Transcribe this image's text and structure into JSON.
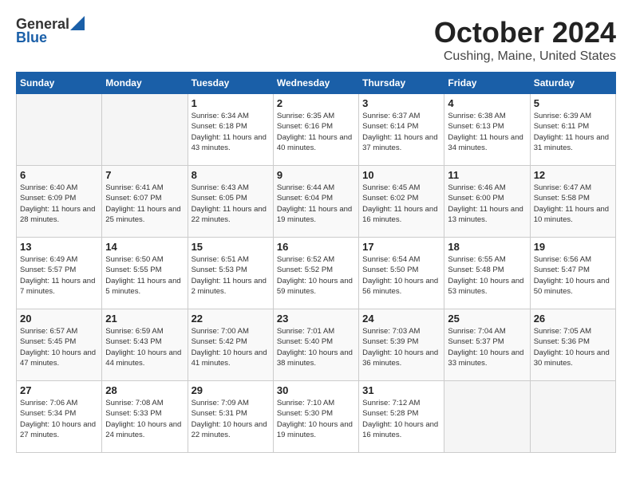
{
  "header": {
    "logo_general": "General",
    "logo_blue": "Blue",
    "month": "October 2024",
    "location": "Cushing, Maine, United States"
  },
  "weekdays": [
    "Sunday",
    "Monday",
    "Tuesday",
    "Wednesday",
    "Thursday",
    "Friday",
    "Saturday"
  ],
  "weeks": [
    [
      {
        "day": "",
        "sunrise": "",
        "sunset": "",
        "daylight": ""
      },
      {
        "day": "",
        "sunrise": "",
        "sunset": "",
        "daylight": ""
      },
      {
        "day": "1",
        "sunrise": "Sunrise: 6:34 AM",
        "sunset": "Sunset: 6:18 PM",
        "daylight": "Daylight: 11 hours and 43 minutes."
      },
      {
        "day": "2",
        "sunrise": "Sunrise: 6:35 AM",
        "sunset": "Sunset: 6:16 PM",
        "daylight": "Daylight: 11 hours and 40 minutes."
      },
      {
        "day": "3",
        "sunrise": "Sunrise: 6:37 AM",
        "sunset": "Sunset: 6:14 PM",
        "daylight": "Daylight: 11 hours and 37 minutes."
      },
      {
        "day": "4",
        "sunrise": "Sunrise: 6:38 AM",
        "sunset": "Sunset: 6:13 PM",
        "daylight": "Daylight: 11 hours and 34 minutes."
      },
      {
        "day": "5",
        "sunrise": "Sunrise: 6:39 AM",
        "sunset": "Sunset: 6:11 PM",
        "daylight": "Daylight: 11 hours and 31 minutes."
      }
    ],
    [
      {
        "day": "6",
        "sunrise": "Sunrise: 6:40 AM",
        "sunset": "Sunset: 6:09 PM",
        "daylight": "Daylight: 11 hours and 28 minutes."
      },
      {
        "day": "7",
        "sunrise": "Sunrise: 6:41 AM",
        "sunset": "Sunset: 6:07 PM",
        "daylight": "Daylight: 11 hours and 25 minutes."
      },
      {
        "day": "8",
        "sunrise": "Sunrise: 6:43 AM",
        "sunset": "Sunset: 6:05 PM",
        "daylight": "Daylight: 11 hours and 22 minutes."
      },
      {
        "day": "9",
        "sunrise": "Sunrise: 6:44 AM",
        "sunset": "Sunset: 6:04 PM",
        "daylight": "Daylight: 11 hours and 19 minutes."
      },
      {
        "day": "10",
        "sunrise": "Sunrise: 6:45 AM",
        "sunset": "Sunset: 6:02 PM",
        "daylight": "Daylight: 11 hours and 16 minutes."
      },
      {
        "day": "11",
        "sunrise": "Sunrise: 6:46 AM",
        "sunset": "Sunset: 6:00 PM",
        "daylight": "Daylight: 11 hours and 13 minutes."
      },
      {
        "day": "12",
        "sunrise": "Sunrise: 6:47 AM",
        "sunset": "Sunset: 5:58 PM",
        "daylight": "Daylight: 11 hours and 10 minutes."
      }
    ],
    [
      {
        "day": "13",
        "sunrise": "Sunrise: 6:49 AM",
        "sunset": "Sunset: 5:57 PM",
        "daylight": "Daylight: 11 hours and 7 minutes."
      },
      {
        "day": "14",
        "sunrise": "Sunrise: 6:50 AM",
        "sunset": "Sunset: 5:55 PM",
        "daylight": "Daylight: 11 hours and 5 minutes."
      },
      {
        "day": "15",
        "sunrise": "Sunrise: 6:51 AM",
        "sunset": "Sunset: 5:53 PM",
        "daylight": "Daylight: 11 hours and 2 minutes."
      },
      {
        "day": "16",
        "sunrise": "Sunrise: 6:52 AM",
        "sunset": "Sunset: 5:52 PM",
        "daylight": "Daylight: 10 hours and 59 minutes."
      },
      {
        "day": "17",
        "sunrise": "Sunrise: 6:54 AM",
        "sunset": "Sunset: 5:50 PM",
        "daylight": "Daylight: 10 hours and 56 minutes."
      },
      {
        "day": "18",
        "sunrise": "Sunrise: 6:55 AM",
        "sunset": "Sunset: 5:48 PM",
        "daylight": "Daylight: 10 hours and 53 minutes."
      },
      {
        "day": "19",
        "sunrise": "Sunrise: 6:56 AM",
        "sunset": "Sunset: 5:47 PM",
        "daylight": "Daylight: 10 hours and 50 minutes."
      }
    ],
    [
      {
        "day": "20",
        "sunrise": "Sunrise: 6:57 AM",
        "sunset": "Sunset: 5:45 PM",
        "daylight": "Daylight: 10 hours and 47 minutes."
      },
      {
        "day": "21",
        "sunrise": "Sunrise: 6:59 AM",
        "sunset": "Sunset: 5:43 PM",
        "daylight": "Daylight: 10 hours and 44 minutes."
      },
      {
        "day": "22",
        "sunrise": "Sunrise: 7:00 AM",
        "sunset": "Sunset: 5:42 PM",
        "daylight": "Daylight: 10 hours and 41 minutes."
      },
      {
        "day": "23",
        "sunrise": "Sunrise: 7:01 AM",
        "sunset": "Sunset: 5:40 PM",
        "daylight": "Daylight: 10 hours and 38 minutes."
      },
      {
        "day": "24",
        "sunrise": "Sunrise: 7:03 AM",
        "sunset": "Sunset: 5:39 PM",
        "daylight": "Daylight: 10 hours and 36 minutes."
      },
      {
        "day": "25",
        "sunrise": "Sunrise: 7:04 AM",
        "sunset": "Sunset: 5:37 PM",
        "daylight": "Daylight: 10 hours and 33 minutes."
      },
      {
        "day": "26",
        "sunrise": "Sunrise: 7:05 AM",
        "sunset": "Sunset: 5:36 PM",
        "daylight": "Daylight: 10 hours and 30 minutes."
      }
    ],
    [
      {
        "day": "27",
        "sunrise": "Sunrise: 7:06 AM",
        "sunset": "Sunset: 5:34 PM",
        "daylight": "Daylight: 10 hours and 27 minutes."
      },
      {
        "day": "28",
        "sunrise": "Sunrise: 7:08 AM",
        "sunset": "Sunset: 5:33 PM",
        "daylight": "Daylight: 10 hours and 24 minutes."
      },
      {
        "day": "29",
        "sunrise": "Sunrise: 7:09 AM",
        "sunset": "Sunset: 5:31 PM",
        "daylight": "Daylight: 10 hours and 22 minutes."
      },
      {
        "day": "30",
        "sunrise": "Sunrise: 7:10 AM",
        "sunset": "Sunset: 5:30 PM",
        "daylight": "Daylight: 10 hours and 19 minutes."
      },
      {
        "day": "31",
        "sunrise": "Sunrise: 7:12 AM",
        "sunset": "Sunset: 5:28 PM",
        "daylight": "Daylight: 10 hours and 16 minutes."
      },
      {
        "day": "",
        "sunrise": "",
        "sunset": "",
        "daylight": ""
      },
      {
        "day": "",
        "sunrise": "",
        "sunset": "",
        "daylight": ""
      }
    ]
  ]
}
